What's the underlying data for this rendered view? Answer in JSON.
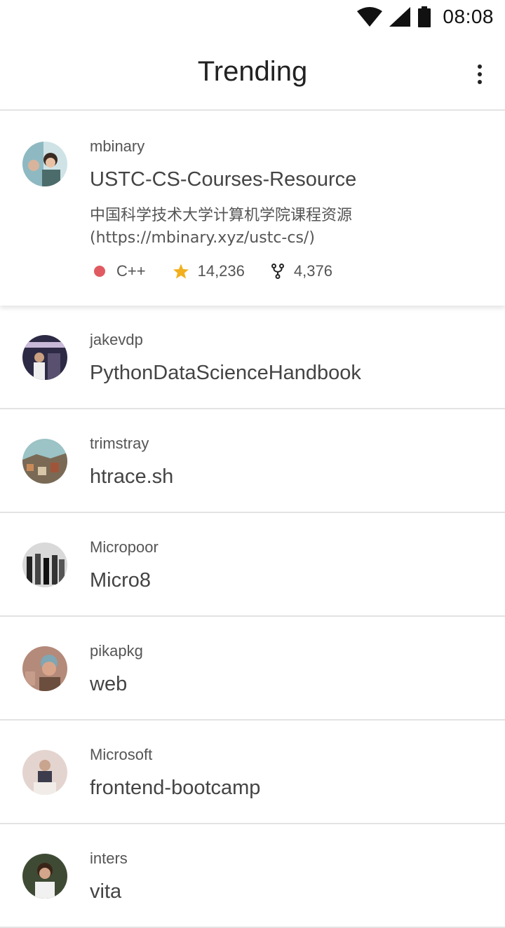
{
  "status_bar": {
    "time": "08:08",
    "icons": [
      "wifi-icon",
      "cellular-signal-icon",
      "battery-icon"
    ]
  },
  "app_bar": {
    "title": "Trending",
    "menu_icon": "more-vert-icon"
  },
  "colors": {
    "cpp_language": "#e05a62",
    "star": "#f2b01e",
    "divider": "#e3e3e3"
  },
  "repos": [
    {
      "owner": "mbinary",
      "name": "USTC-CS-Courses-Resource",
      "description": "中国科学技术大学计算机学院课程资源(https://mbinary.xyz/ustc-cs/)",
      "language": "C++",
      "stars": "14,236",
      "forks": "4,376"
    },
    {
      "owner": "jakevdp",
      "name": "PythonDataScienceHandbook"
    },
    {
      "owner": "trimstray",
      "name": "htrace.sh"
    },
    {
      "owner": "Micropoor",
      "name": "Micro8"
    },
    {
      "owner": "pikapkg",
      "name": "web"
    },
    {
      "owner": "Microsoft",
      "name": "frontend-bootcamp"
    },
    {
      "owner": "inters",
      "name": "vita"
    }
  ]
}
